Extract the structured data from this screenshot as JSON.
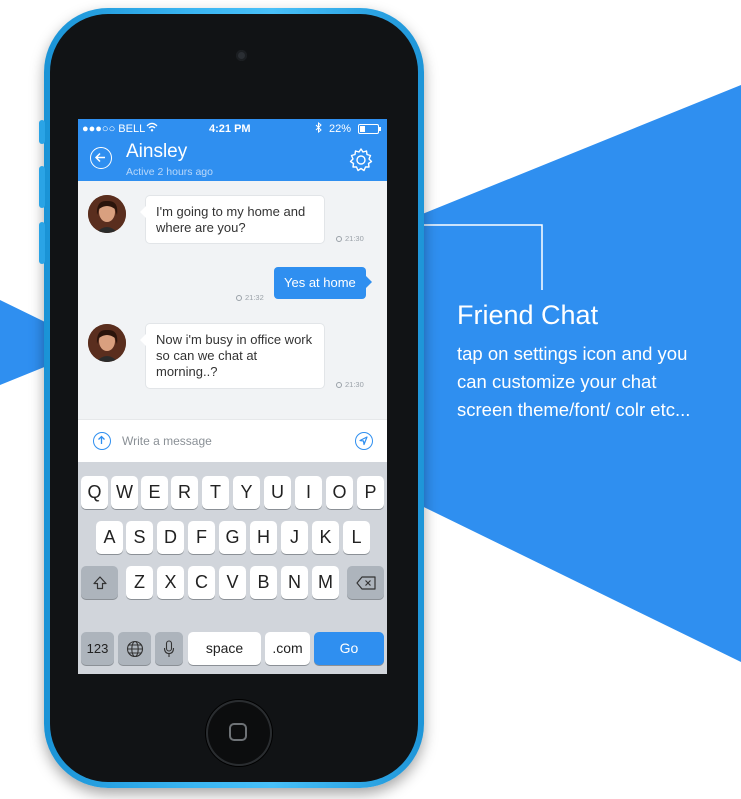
{
  "statusbar": {
    "carrier": "●●●○○ BELL",
    "time": "4:21 PM",
    "battery": "22%"
  },
  "header": {
    "contact_name": "Ainsley",
    "contact_status": "Active 2 hours ago"
  },
  "messages": [
    {
      "direction": "incoming",
      "text": "I'm going to my home and where are you?",
      "time": "21:30"
    },
    {
      "direction": "outgoing",
      "text": "Yes at home",
      "time": "21:32"
    },
    {
      "direction": "incoming",
      "text": "Now i'm busy in office work so can we chat at morning..?",
      "time": "21:30"
    }
  ],
  "composer": {
    "placeholder": "Write a message"
  },
  "keyboard": {
    "row1": [
      "Q",
      "W",
      "E",
      "R",
      "T",
      "Y",
      "U",
      "I",
      "O",
      "P"
    ],
    "row2": [
      "A",
      "S",
      "D",
      "F",
      "G",
      "H",
      "J",
      "K",
      "L"
    ],
    "row3": [
      "Z",
      "X",
      "C",
      "V",
      "B",
      "N",
      "M"
    ],
    "numbers_label": "123",
    "space_label": "space",
    "dotcom_label": ".com",
    "go_label": "Go"
  },
  "callout": {
    "title": "Friend Chat",
    "body": "tap on settings icon and you can customize your chat screen theme/font/ colr etc..."
  },
  "colors": {
    "accent": "#2f8ff0",
    "background_shape": "#2f8ff0"
  }
}
